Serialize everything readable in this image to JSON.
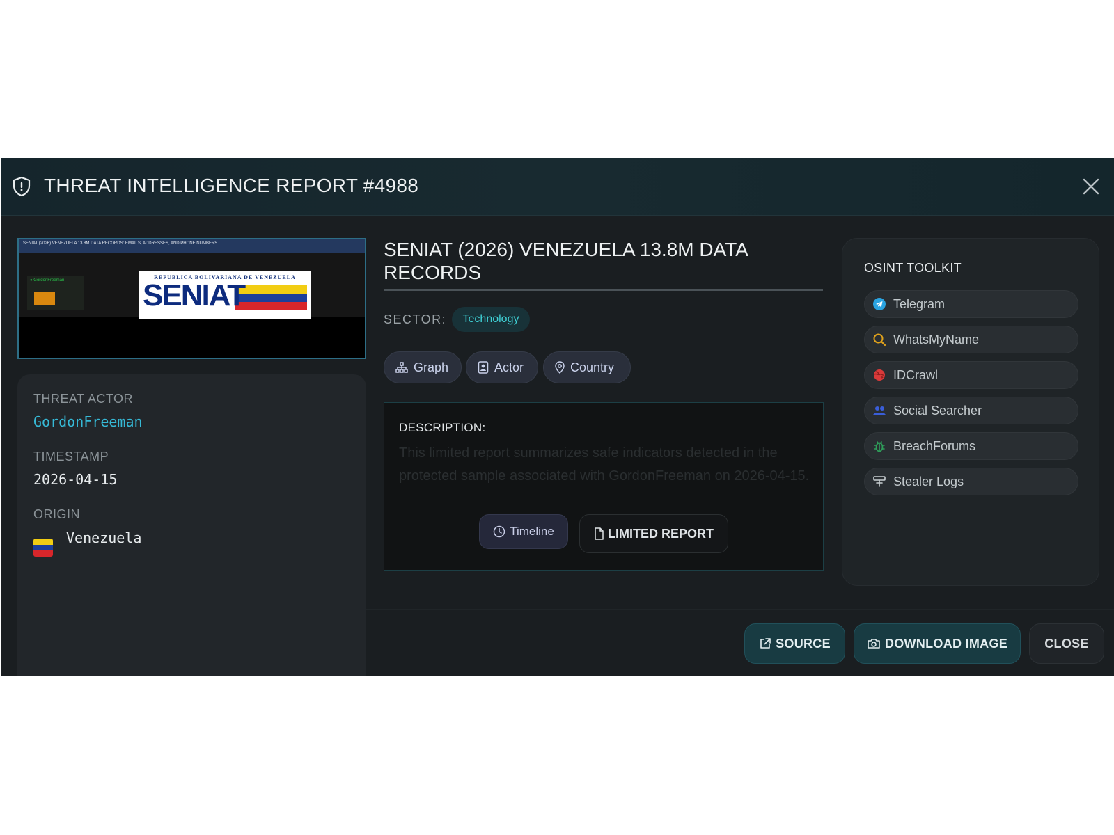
{
  "modal": {
    "title": "THREAT INTELLIGENCE REPORT #4988",
    "close_icon": "close-icon"
  },
  "preview": {
    "caption": "SENIAT (2026) VENEZUELA 13.8M DATA RECORDS: EMAILS, ADDRESSES, AND PHONE NUMBERS.",
    "sidebar_label": "● GordonFreeman",
    "logo_top": "REPUBLICA BOLIVARIANA DE VENEZUELA",
    "logo_word": "SENIAT"
  },
  "info": {
    "actor_label": "THREAT ACTOR",
    "actor": "GordonFreeman",
    "timestamp_label": "TIMESTAMP",
    "timestamp": "2026-04-15",
    "origin_label": "ORIGIN",
    "origin": "Venezuela",
    "flag_colors": [
      "#f2cd13",
      "#1d3f9a",
      "#d8262b"
    ]
  },
  "report": {
    "title": "SENIAT (2026) VENEZUELA 13.8M DATA RECORDS",
    "sector_label": "SECTOR:",
    "sector": "Technology",
    "pills": [
      "Graph",
      "Actor",
      "Country"
    ],
    "description_label": "DESCRIPTION:",
    "description": "This limited report summarizes safe indicators detected in the protected sample associated with GordonFreeman on 2026-04-15.",
    "timeline_label": "Timeline",
    "limited_label": "LIMITED REPORT"
  },
  "osint": {
    "title": "OSINT TOOLKIT",
    "items": [
      {
        "label": "Telegram",
        "icon": "telegram-icon",
        "color": "#2aa3e0"
      },
      {
        "label": "WhatsMyName",
        "icon": "search-icon",
        "color": "#e0a21c"
      },
      {
        "label": "IDCrawl",
        "icon": "globe-icon",
        "color": "#d93a3a"
      },
      {
        "label": "Social Searcher",
        "icon": "users-icon",
        "color": "#3a5ed9"
      },
      {
        "label": "BreachForums",
        "icon": "bug-icon",
        "color": "#2f9e5a"
      },
      {
        "label": "Stealer Logs",
        "icon": "logs-icon",
        "color": "#c9cfd2"
      }
    ]
  },
  "footer": {
    "source_label": "SOURCE",
    "download_label": "DOWNLOAD IMAGE",
    "close_label": "CLOSE"
  },
  "colors": {
    "accent": "#36b9d6",
    "modal_bg": "#1a1e21",
    "button_teal": "#183b42"
  }
}
